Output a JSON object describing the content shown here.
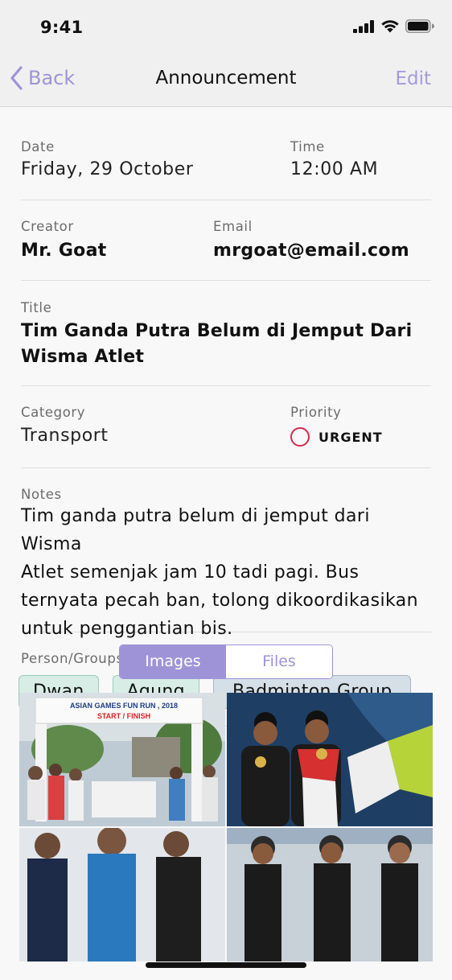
{
  "status": {
    "time": "9:41"
  },
  "nav": {
    "back_label": "Back",
    "title": "Announcement",
    "edit_label": "Edit"
  },
  "details": {
    "date_label": "Date",
    "date_value": "Friday, 29 October",
    "time_label": "Time",
    "time_value": "12:00 AM",
    "creator_label": "Creator",
    "creator_value": "Mr. Goat",
    "email_label": "Email",
    "email_value": "mrgoat@email.com",
    "title_label": "Title",
    "title_line1": "Tim Ganda Putra Belum di Jemput Dari",
    "title_line2": "Wisma Atlet",
    "category_label": "Category",
    "category_value": "Transport",
    "priority_label": "Priority",
    "priority_value": "URGENT",
    "notes_label": "Notes",
    "notes_lines": [
      "Tim ganda putra belum di jemput dari Wisma",
      "Atlet semenjak jam 10 tadi pagi. Bus",
      "ternyata pecah ban, tolong dikoordikasikan",
      "untuk penggantian bis."
    ],
    "groups_label": "Person/Groups",
    "groups": [
      "Dwan",
      "Agung",
      "Badminton Group"
    ]
  },
  "tabs": [
    "Images",
    "Files"
  ],
  "active_tab": "Images",
  "photos": {
    "banner_line1": "ASIAN GAMES FUN RUN , 2018",
    "banner_line2": "START / FINISH"
  },
  "colors": {
    "accent": "#9f93d8",
    "urgent": "#d6294a",
    "chip_green": "#d7ede6",
    "chip_blue": "#d5dfe7"
  }
}
